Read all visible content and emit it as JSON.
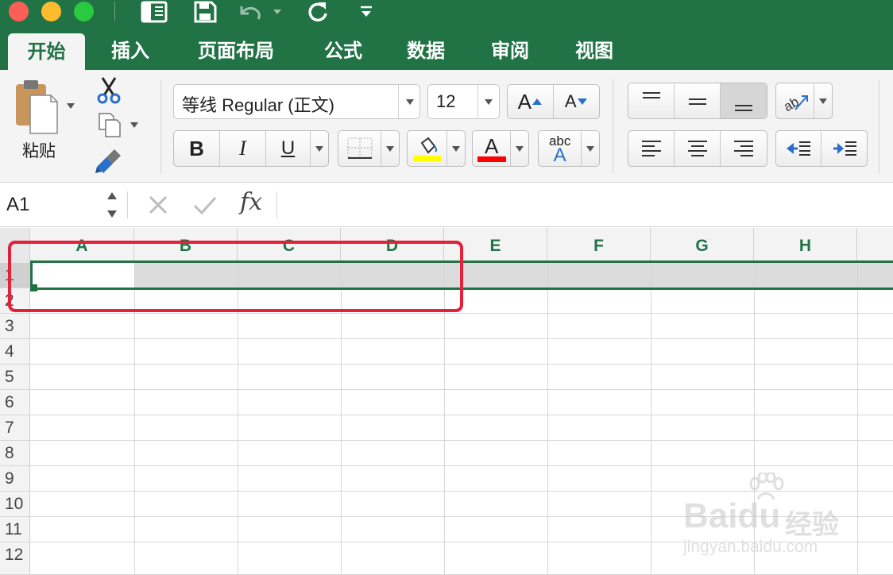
{
  "quick_access": {
    "icons": [
      "sidebar-icon",
      "save-icon",
      "undo-icon",
      "redo-icon",
      "customize-icon"
    ]
  },
  "tabs": [
    {
      "label": "开始",
      "active": true
    },
    {
      "label": "插入",
      "active": false
    },
    {
      "label": "页面布局",
      "active": false
    },
    {
      "label": "公式",
      "active": false
    },
    {
      "label": "数据",
      "active": false
    },
    {
      "label": "审阅",
      "active": false
    },
    {
      "label": "视图",
      "active": false
    }
  ],
  "ribbon": {
    "paste_label": "粘贴",
    "font_name": "等线 Regular (正文)",
    "font_size": "12",
    "bold_label": "B",
    "italic_label": "I",
    "underline_label": "U",
    "grow_font_label": "A",
    "shrink_font_label": "A",
    "font_color_label": "A",
    "phonetic_small": "abc",
    "phonetic_big": "A",
    "orientation_label": "ab",
    "fill_color": "#ffff00",
    "font_color": "#ff0000"
  },
  "formula_bar": {
    "name_box": "A1",
    "fx_label": "fx",
    "cancel_icon": "cross-icon",
    "enter_icon": "check-icon",
    "formula": ""
  },
  "sheet": {
    "columns": [
      "A",
      "B",
      "C",
      "D",
      "E",
      "F",
      "G",
      "H"
    ],
    "rows": [
      "1",
      "2",
      "3",
      "4",
      "5",
      "6",
      "7",
      "8",
      "9",
      "10",
      "11",
      "12"
    ],
    "active_cell": "A1",
    "selected_row": "1"
  },
  "watermark": {
    "brand": "Baidu",
    "brand_cn": "经验",
    "url": "jingyan.baidu.com"
  },
  "colors": {
    "accent": "#217346",
    "highlight": "#e5203a"
  }
}
